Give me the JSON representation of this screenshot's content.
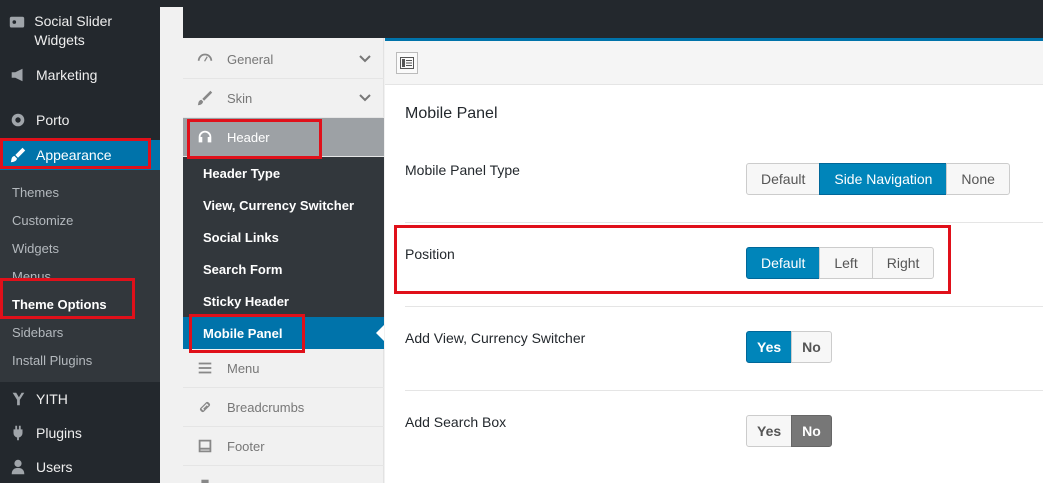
{
  "wp_menu": {
    "items": [
      {
        "label": "Social Slider Widgets",
        "icon": "slider-icon"
      },
      {
        "label": "Marketing",
        "icon": "megaphone-icon"
      },
      {
        "label": "Porto",
        "icon": "circle-icon"
      },
      {
        "label": "Appearance",
        "icon": "brush-icon"
      }
    ],
    "submenu": [
      "Themes",
      "Customize",
      "Widgets",
      "Menus",
      "Theme Options",
      "Sidebars",
      "Install Plugins"
    ],
    "items_after": [
      {
        "label": "YITH",
        "icon": "yith-icon"
      },
      {
        "label": "Plugins",
        "icon": "plug-icon"
      },
      {
        "label": "Users",
        "icon": "user-icon"
      }
    ]
  },
  "options_nav": {
    "items": [
      "General",
      "Skin",
      "Header"
    ],
    "header_sub": [
      "Header Type",
      "View, Currency Switcher",
      "Social Links",
      "Search Form",
      "Sticky Header",
      "Mobile Panel"
    ],
    "items_after": [
      "Menu",
      "Breadcrumbs",
      "Footer"
    ]
  },
  "panel": {
    "section_title": "Mobile Panel",
    "rows": [
      {
        "label": "Mobile Panel Type",
        "options": [
          "Default",
          "Side Navigation",
          "None"
        ],
        "selected": "Side Navigation"
      },
      {
        "label": "Position",
        "options": [
          "Default",
          "Left",
          "Right"
        ],
        "selected": "Default"
      },
      {
        "label": "Add View, Currency Switcher",
        "options": [
          "Yes",
          "No"
        ],
        "selected": "Yes"
      },
      {
        "label": "Add Search Box",
        "options": [
          "Yes",
          "No"
        ],
        "selected": "No"
      }
    ]
  },
  "colors": {
    "accent": "#0073aa",
    "highlight": "#e0101a"
  }
}
